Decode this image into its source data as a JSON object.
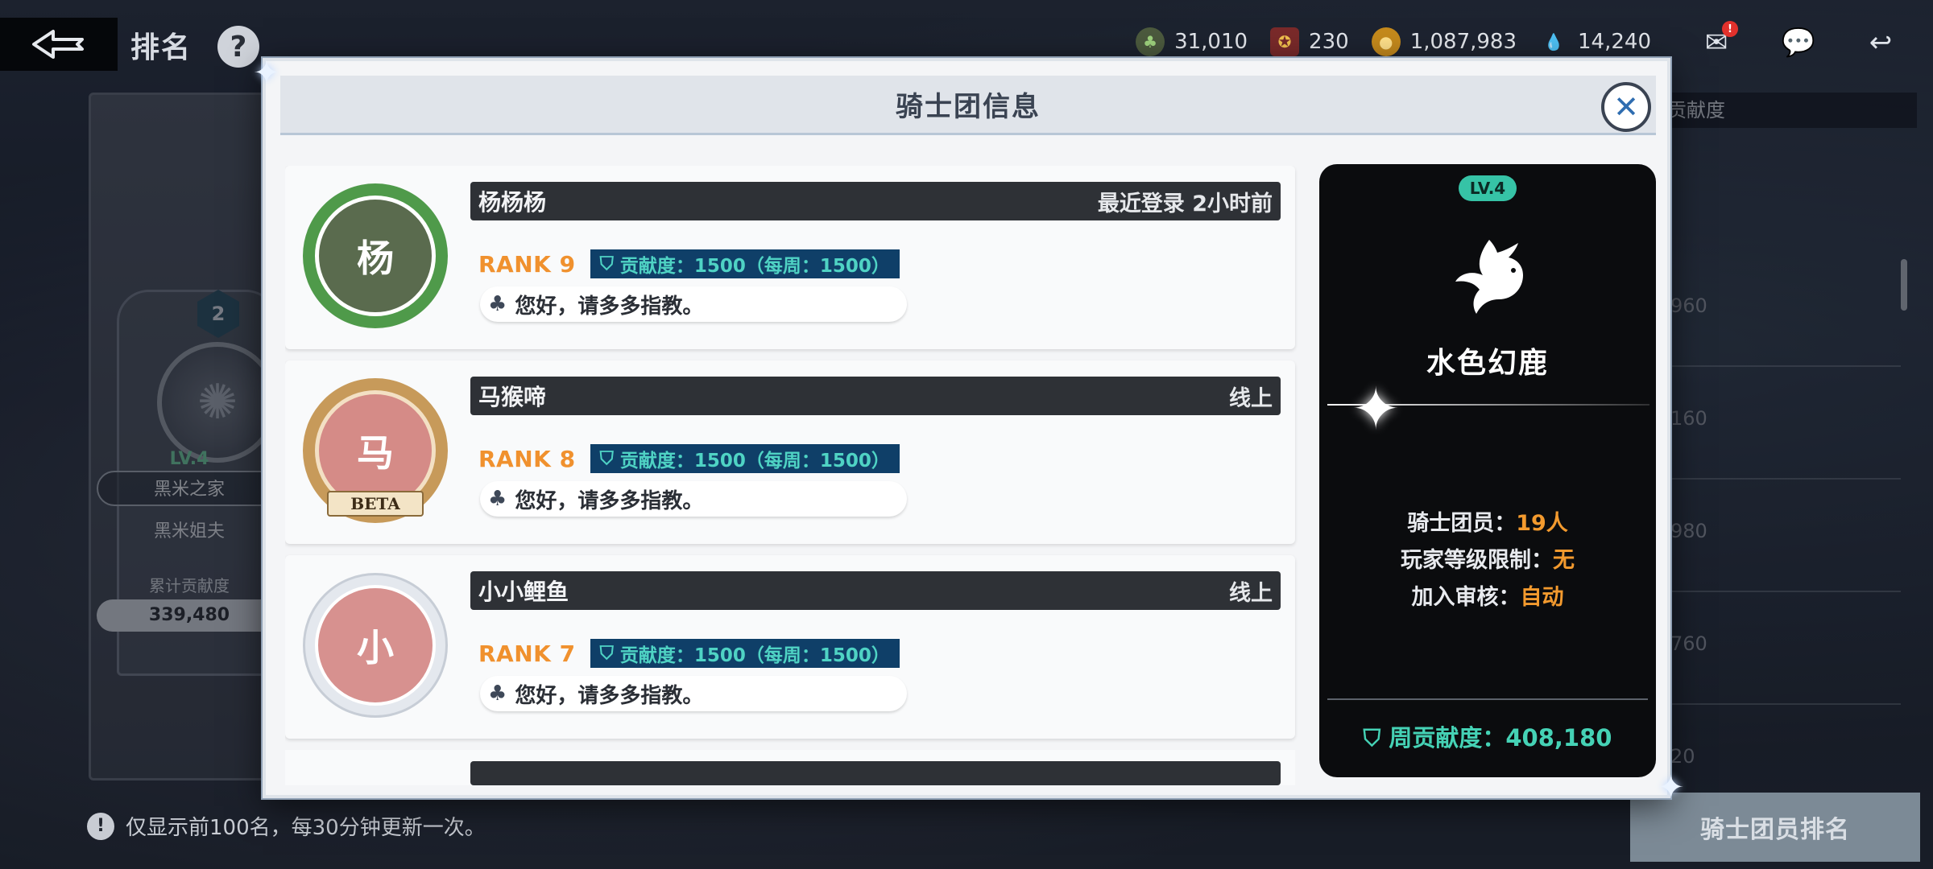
{
  "header": {
    "title": "排名",
    "help_label": "?"
  },
  "currencies": [
    {
      "icon": "clover-coin-icon",
      "value": "31,010"
    },
    {
      "icon": "medal-icon",
      "value": "230"
    },
    {
      "icon": "gold-coin-icon",
      "value": "1,087,983"
    },
    {
      "icon": "water-drop-icon",
      "value": "14,240"
    }
  ],
  "top_icons": {
    "mail_badge": "!"
  },
  "background": {
    "left_panel": {
      "rank_badge": "2",
      "level": "LV.4",
      "guild_name": "黑米之家",
      "leader": "黑米姐夫",
      "contribution_label": "累计贡献度",
      "contribution_value": "339,480"
    },
    "right_header": "贡献度",
    "right_values": [
      "960",
      "160",
      "980",
      "760",
      "20"
    ],
    "notice": "仅显示前100名，每30分钟更新一次。",
    "members_rank_button": "骑士团员排名"
  },
  "modal": {
    "title": "骑士团信息",
    "close_label": "✕",
    "members": [
      {
        "name": "杨杨杨",
        "status": "最近登录  2小时前",
        "rank": "RANK 9",
        "contribution": "贡献度：1500（每周：1500）",
        "greeting": "您好，请多多指教。",
        "avatar_initial": "杨",
        "avatar_color": "#5a6b4e",
        "avatar_ring": "#4f9a4a"
      },
      {
        "name": "马猴啼",
        "status": "线上",
        "rank": "RANK 8",
        "contribution": "贡献度：1500（每周：1500）",
        "greeting": "您好，请多多指教。",
        "avatar_initial": "马",
        "avatar_color": "#d58b87",
        "avatar_ring": "#c79a5a",
        "avatar_banner": "BETA"
      },
      {
        "name": "小小鲤鱼",
        "status": "线上",
        "rank": "RANK 7",
        "contribution": "贡献度：1500（每周：1500）",
        "greeting": "您好，请多多指教。",
        "avatar_initial": "小",
        "avatar_color": "#d7918f",
        "avatar_ring": "#dfe3ea"
      }
    ],
    "guild": {
      "level": "LV.4",
      "emblem_icon": "white-bird-emblem-icon",
      "name": "水色幻鹿",
      "members_label": "骑士团员：",
      "members_value": "19人",
      "level_limit_label": "玩家等级限制：",
      "level_limit_value": "无",
      "review_label": "加入审核：",
      "review_value": "自动",
      "weekly_contribution": "周贡献度：408,180"
    }
  }
}
